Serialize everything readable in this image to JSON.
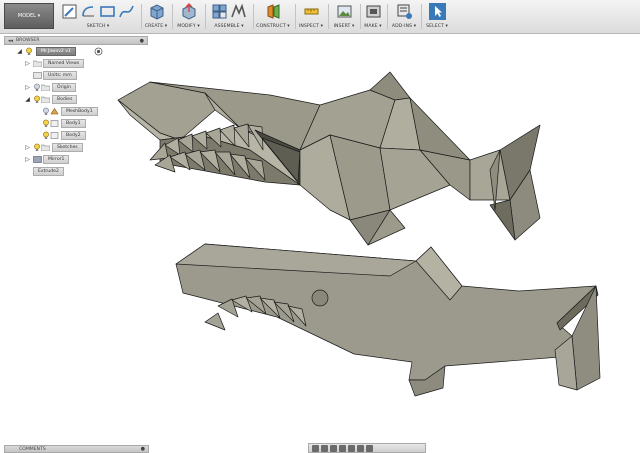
{
  "workspace": {
    "label": "MODEL",
    "arrow": "▾"
  },
  "toolbar": {
    "groups": [
      {
        "id": "sketch",
        "label": "SKETCH ▾"
      },
      {
        "id": "create",
        "label": "CREATE ▾"
      },
      {
        "id": "modify",
        "label": "MODIFY ▾"
      },
      {
        "id": "assemble",
        "label": "ASSEMBLE ▾"
      },
      {
        "id": "construct",
        "label": "CONSTRUCT ▾"
      },
      {
        "id": "inspect",
        "label": "INSPECT ▾"
      },
      {
        "id": "insert",
        "label": "INSERT ▾"
      },
      {
        "id": "make",
        "label": "MAKE ▾"
      },
      {
        "id": "addins",
        "label": "ADD-INS ▾"
      },
      {
        "id": "select",
        "label": "SELECT ▾"
      }
    ]
  },
  "browser": {
    "title": "BROWSER",
    "collapse_glyph": "◂◂",
    "pin_glyph": "●",
    "root": {
      "label": "Mr.Jawsv2 v1"
    },
    "items": [
      {
        "label": "Named Views"
      },
      {
        "label": "Units: mm"
      },
      {
        "label": "Origin"
      },
      {
        "label": "Bodies"
      },
      {
        "label": "MeshBody1"
      },
      {
        "label": "Body1"
      },
      {
        "label": "Body2"
      },
      {
        "label": "Sketches"
      },
      {
        "label": "Mirror1"
      },
      {
        "label": "Extrude2"
      }
    ]
  },
  "comments": {
    "title": "COMMENTS",
    "pin_glyph": "●"
  },
  "colors": {
    "model_face": "#9c9a8c",
    "model_edge": "#1a1a1a",
    "toolbar_bg": "#e6e6e6",
    "select_accent": "#3a79b8"
  }
}
